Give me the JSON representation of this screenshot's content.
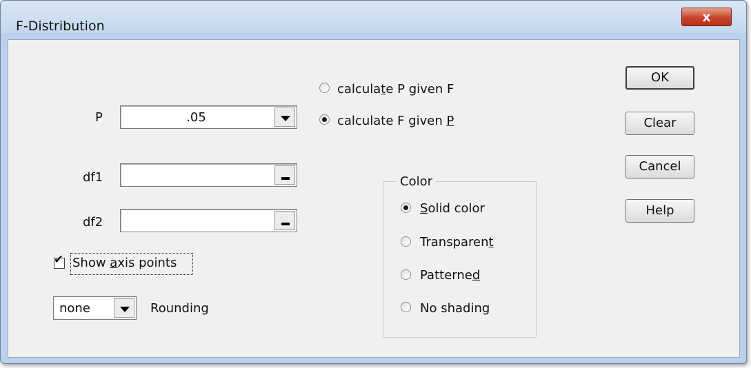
{
  "window": {
    "title": "F-Distribution",
    "close_glyph": "x"
  },
  "labels": {
    "p": "P",
    "df1": "df1",
    "df2": "df2",
    "rounding": "Rounding"
  },
  "inputs": {
    "p_value": ".05",
    "df1_value": "",
    "df2_value": ""
  },
  "mode": {
    "calc_p": {
      "pre": "calcula",
      "ul": "t",
      "post": "e P given F",
      "selected": false
    },
    "calc_f": {
      "pre": "calculate F given ",
      "ul": "P",
      "post": "",
      "selected": true
    }
  },
  "options": {
    "show_axis": {
      "pre": "Show ",
      "ul": "a",
      "post": "xis points",
      "checked": true
    }
  },
  "rounding": {
    "value": "none"
  },
  "color_group": {
    "title": "Color",
    "solid": {
      "pre": "",
      "ul": "S",
      "post": "olid color",
      "selected": true
    },
    "transparent": {
      "pre": "Transparen",
      "ul": "t",
      "post": "",
      "selected": false
    },
    "patterned": {
      "pre": "Patterne",
      "ul": "d",
      "post": "",
      "selected": false
    },
    "no_shading": {
      "pre": "No shadin",
      "ul": "g",
      "post": "",
      "selected": false
    }
  },
  "buttons": {
    "ok": "OK",
    "clear": "Clear",
    "cancel": "Cancel",
    "help": "Help"
  },
  "icons": {
    "checkmark": "check-icon",
    "dropdown": "chevron-down-icon",
    "minimize": "minus-icon",
    "close": "close-icon"
  }
}
